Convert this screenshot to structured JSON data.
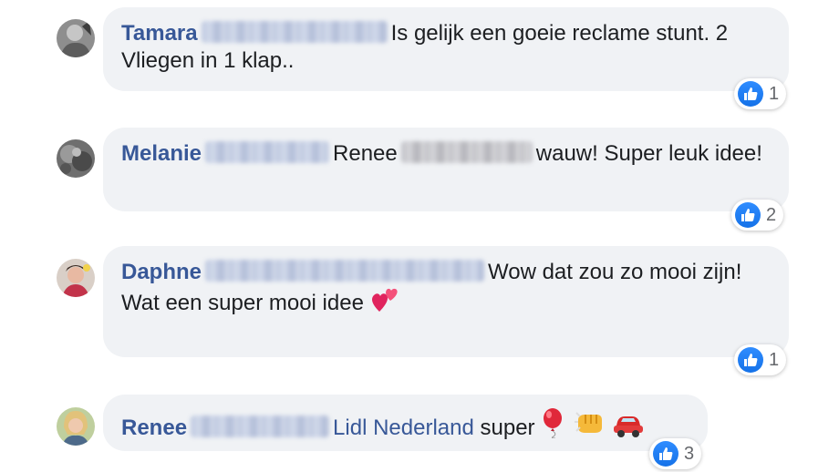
{
  "comments": [
    {
      "author": "Tamara",
      "text": "Is gelijk een goeie reclame stunt. 2 Vliegen in 1 klap..",
      "likes": "1"
    },
    {
      "author": "Melanie",
      "mention": "Renee",
      "text": "wauw! Super leuk idee!",
      "likes": "2"
    },
    {
      "author": "Daphne",
      "text_line1": "Wow dat zou zo mooi zijn!",
      "text_line2": "Wat een super mooi idee",
      "emoji_icon": "two-hearts-icon",
      "likes": "1"
    },
    {
      "author": "Renee",
      "mention": "Lidl Nederland",
      "text": "super",
      "emoji_icons": [
        "balloon-icon",
        "fist-bump-icon",
        "car-icon"
      ],
      "likes": "3"
    }
  ],
  "colors": {
    "bubble": "#f0f2f5",
    "name": "#385898",
    "text": "#1c1e21",
    "like": "#1877f2"
  }
}
